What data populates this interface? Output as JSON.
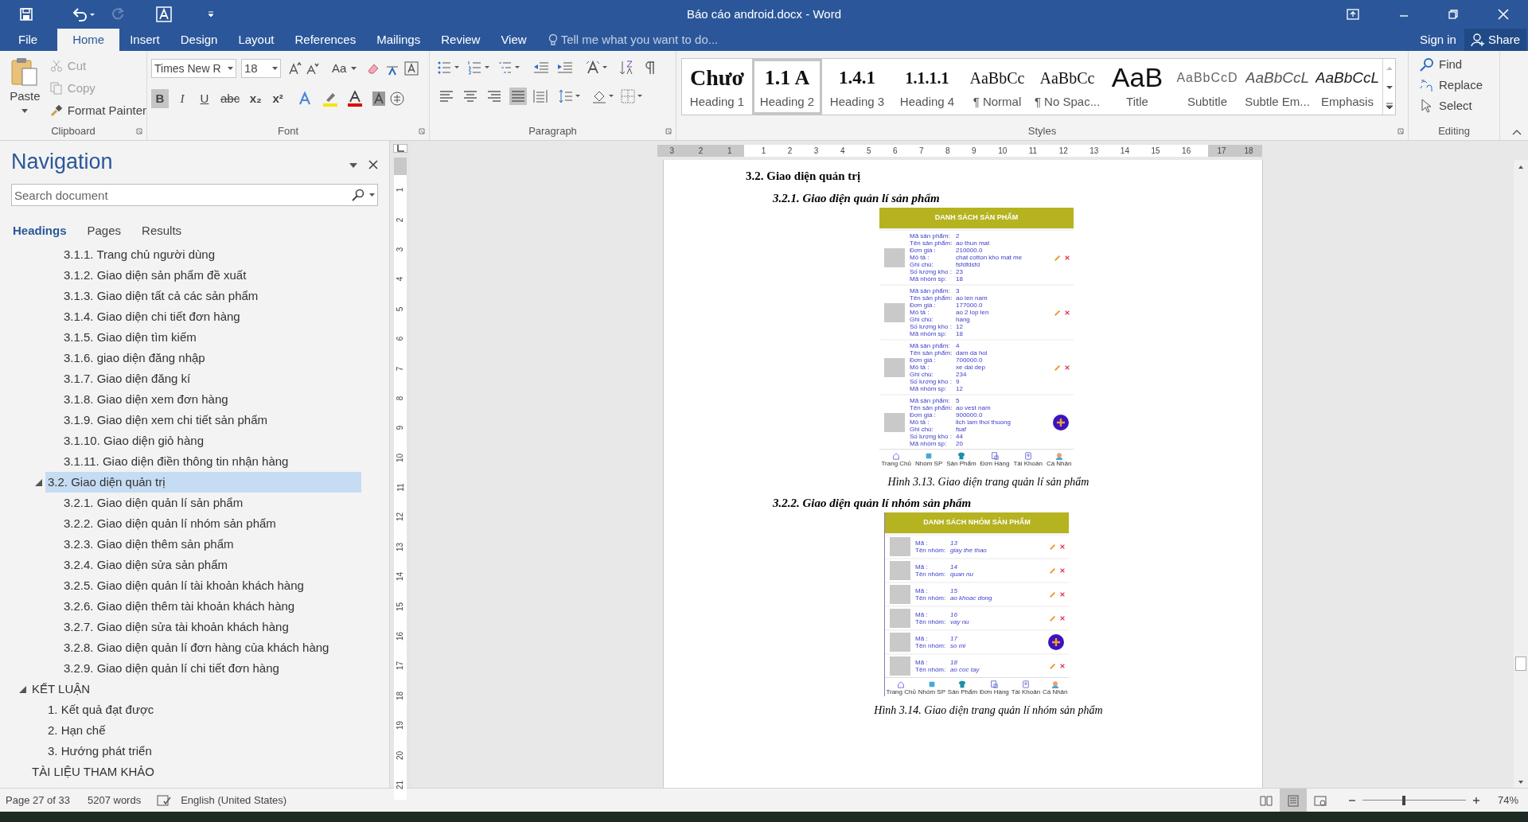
{
  "window": {
    "title": "Báo cáo android.docx - Word"
  },
  "ribbon_tabs": [
    {
      "label": "File",
      "selected": false
    },
    {
      "label": "Home",
      "selected": true
    },
    {
      "label": "Insert",
      "selected": false
    },
    {
      "label": "Design",
      "selected": false
    },
    {
      "label": "Layout",
      "selected": false
    },
    {
      "label": "References",
      "selected": false
    },
    {
      "label": "Mailings",
      "selected": false
    },
    {
      "label": "Review",
      "selected": false
    },
    {
      "label": "View",
      "selected": false
    }
  ],
  "tell_me": {
    "placeholder": "Tell me what you want to do..."
  },
  "account": {
    "sign_in": "Sign in",
    "share": "Share"
  },
  "clipboard": {
    "paste": "Paste",
    "cut": "Cut",
    "copy": "Copy",
    "format_painter": "Format Painter",
    "label": "Clipboard"
  },
  "font": {
    "name": "Times New R",
    "size": "18",
    "change_case": "Aa",
    "label": "Font",
    "format_buttons": [
      {
        "kind": "bold",
        "glyph": "B",
        "selected": true
      },
      {
        "kind": "italic",
        "glyph": "I",
        "selected": false
      },
      {
        "kind": "underline",
        "glyph": "U",
        "selected": false
      },
      {
        "kind": "strike",
        "glyph": "abc",
        "selected": false
      },
      {
        "kind": "sub",
        "glyph": "x₂",
        "selected": false
      },
      {
        "kind": "sup",
        "glyph": "x²",
        "selected": false
      }
    ]
  },
  "paragraph": {
    "label": "Paragraph",
    "alignment": [
      {
        "kind": "left",
        "selected": false
      },
      {
        "kind": "center",
        "selected": false
      },
      {
        "kind": "right",
        "selected": false
      },
      {
        "kind": "justify",
        "selected": true
      }
    ]
  },
  "styles": {
    "label": "Styles",
    "items": [
      {
        "kind": "heading1",
        "preview": "Chươ",
        "label": "Heading 1",
        "selected": false
      },
      {
        "kind": "heading2",
        "preview": "1.1  A",
        "label": "Heading 2",
        "selected": true
      },
      {
        "kind": "heading3",
        "preview": "1.4.1",
        "label": "Heading 3",
        "selected": false
      },
      {
        "kind": "heading4",
        "preview": "1.1.1.1",
        "label": "Heading 4",
        "selected": false
      },
      {
        "kind": "normal",
        "preview": "AaBbCc",
        "label": "¶ Normal",
        "selected": false
      },
      {
        "kind": "normal",
        "preview": "AaBbCc",
        "label": "¶ No Spac...",
        "selected": false
      },
      {
        "kind": "title",
        "preview": "AaB",
        "label": "Title",
        "selected": false
      },
      {
        "kind": "subtitle",
        "preview": "AaBbCcD",
        "label": "Subtitle",
        "selected": false
      },
      {
        "kind": "subtle",
        "preview": "AaBbCcL",
        "label": "Subtle Em...",
        "selected": false
      },
      {
        "kind": "emphasis",
        "preview": "AaBbCcL",
        "label": "Emphasis",
        "selected": false
      }
    ]
  },
  "editing": {
    "label": "Editing",
    "find": "Find",
    "replace": "Replace",
    "select": "Select"
  },
  "navigation": {
    "title": "Navigation",
    "search": {
      "placeholder": "Search document"
    },
    "tabs": [
      {
        "label": "Headings",
        "selected": true
      },
      {
        "label": "Pages",
        "selected": false
      },
      {
        "label": "Results",
        "selected": false
      }
    ],
    "headings": [
      {
        "children": [
          {
            "children": [
              {
                "label": "3.1.1. Trang chủ người dùng",
                "selected": false
              },
              {
                "label": "3.1.2. Giao diện sản phẩm đề xuất",
                "selected": false
              },
              {
                "label": "3.1.3. Giao diện tất cả các sản phẩm",
                "selected": false
              },
              {
                "label": "3.1.4. Giao diện chi tiết đơn hàng",
                "selected": false
              },
              {
                "label": "3.1.5. Giao diện tìm kiếm",
                "selected": false
              },
              {
                "label": "3.1.6. giao diện đăng nhập",
                "selected": false
              },
              {
                "label": "3.1.7. Giao diện đăng kí",
                "selected": false
              },
              {
                "label": "3.1.8. Giao diện xem đơn hàng",
                "selected": false
              },
              {
                "label": "3.1.9. Giao diện xem chi tiết sản phẩm",
                "selected": false
              },
              {
                "label": "3.1.10. Giao diện giỏ hàng",
                "selected": false
              },
              {
                "label": "3.1.11. Giao diện điền thông tin nhận hàng",
                "selected": false
              }
            ]
          },
          {
            "label": "3.2. Giao diện quản trị",
            "selected": true,
            "expanded": true,
            "children": [
              {
                "label": "3.2.1. Giao diện quản lí sản phẩm",
                "selected": false
              },
              {
                "label": "3.2.2. Giao diện quản lí nhóm sản phẩm",
                "selected": false
              },
              {
                "label": "3.2.3. Giao diện thêm sản phẩm",
                "selected": false
              },
              {
                "label": "3.2.4. Giao diện sửa sản phẩm",
                "selected": false
              },
              {
                "label": "3.2.5. Giao diện quản lí tài khoản khách hàng",
                "selected": false
              },
              {
                "label": "3.2.6. Giao diện thêm tài khoản khách hàng",
                "selected": false
              },
              {
                "label": "3.2.7. Giao diện sửa tài khoản khách hàng",
                "selected": false
              },
              {
                "label": "3.2.8. Giao diện quản lí đơn hàng của khách hàng",
                "selected": false
              },
              {
                "label": "3.2.9. Giao diện quản lí chi tiết đơn hàng",
                "selected": false
              }
            ]
          }
        ]
      },
      {
        "label": "KẾT LUẬN",
        "selected": false,
        "expanded": true,
        "children": [
          {
            "label": "1. Kết quả đạt được",
            "selected": false
          },
          {
            "label": "2. Hạn chế",
            "selected": false
          },
          {
            "label": "3. Hướng phát triển",
            "selected": false
          }
        ]
      },
      {
        "label": "TÀI LIỆU THAM KHẢO",
        "selected": false
      }
    ]
  },
  "ruler": {
    "horizontal": [
      "3",
      "2",
      "1",
      "1",
      "2",
      "3",
      "4",
      "5",
      "6",
      "7",
      "8",
      "9",
      "10",
      "11",
      "12",
      "13",
      "14",
      "15",
      "16",
      "17",
      "18"
    ],
    "vertical": [
      "1",
      "2",
      "3",
      "4",
      "5",
      "6",
      "7",
      "8",
      "9",
      "10",
      "11",
      "12",
      "13",
      "14",
      "15",
      "16",
      "17",
      "18",
      "19",
      "20",
      "21"
    ]
  },
  "document": {
    "heading": "3.2. Giao diện quản trị",
    "sections": [
      {
        "kind": "products",
        "heading": "3.2.1. Giao diện quản lí sản phẩm",
        "caption": "Hình 3.13. Giao diện trang quản lí sản phẩm",
        "screen": {
          "header": "DANH SÁCH  SẢN PHẨM",
          "nav": [
            "Trang Chủ",
            "Nhóm SP",
            "Sản Phẩm",
            "Đơn Hàng",
            "Tài Khoản",
            "Cá Nhân"
          ],
          "items": [
            {
              "fields": [
                {
                  "label": "Mã sản phẩm:",
                  "value": "2"
                },
                {
                  "label": "Tên sản phẩm:",
                  "value": "ao thun mat"
                },
                {
                  "label": "Đơn giá :",
                  "value": "210000.0"
                },
                {
                  "label": "Mô tả :",
                  "value": "chat cotton kho mat me"
                },
                {
                  "label": "Ghi chú:",
                  "value": "fsfdfdsfd"
                },
                {
                  "label": "Số lượng kho :",
                  "value": "23"
                },
                {
                  "label": "Mã nhóm sp:",
                  "value": "18"
                }
              ]
            },
            {
              "fields": [
                {
                  "label": "Mã sản phẩm:",
                  "value": "3"
                },
                {
                  "label": "Tên sản phẩm:",
                  "value": "ao len nam"
                },
                {
                  "label": "Đơn giá :",
                  "value": "177000.0"
                },
                {
                  "label": "Mô tả :",
                  "value": "ao 2 lop len"
                },
                {
                  "label": "Ghi chú:",
                  "value": "hang"
                },
                {
                  "label": "Số lượng kho :",
                  "value": "12"
                },
                {
                  "label": "Mã nhóm sp:",
                  "value": "18"
                }
              ]
            },
            {
              "fields": [
                {
                  "label": "Mã sản phẩm:",
                  "value": "4"
                },
                {
                  "label": "Tên sản phẩm:",
                  "value": "dam da hoi"
                },
                {
                  "label": "Đơn giá :",
                  "value": "700000.0"
                },
                {
                  "label": "Mô tả :",
                  "value": "xe dai dep"
                },
                {
                  "label": "Ghi chú:",
                  "value": "234"
                },
                {
                  "label": "Số lượng kho :",
                  "value": "9"
                },
                {
                  "label": "Mã nhóm sp:",
                  "value": "12"
                }
              ]
            },
            {
              "fields": [
                {
                  "label": "Mã sản phẩm:",
                  "value": "5"
                },
                {
                  "label": "Tên sản phẩm:",
                  "value": "ao vest nam"
                },
                {
                  "label": "Đơn giá :",
                  "value": "900000.0"
                },
                {
                  "label": "Mô tả :",
                  "value": "lich lam thoi thuong"
                },
                {
                  "label": "Ghi chú:",
                  "value": "fsaf"
                },
                {
                  "label": "Số lượng kho :",
                  "value": "44"
                },
                {
                  "label": "Mã nhóm sp:",
                  "value": "20"
                }
              ]
            }
          ]
        }
      },
      {
        "kind": "groups",
        "heading": "3.2.2. Giao diện quản lí nhóm sản phẩm",
        "caption": "Hình 3.14. Giao diện trang quản lí nhóm sản phẩm",
        "screen": {
          "header": "DANH SÁCH NHÓM SẢN PHẨM",
          "nav": [
            "Trang Chủ",
            "Nhóm SP",
            "Sản Phẩm",
            "Đơn Hàng",
            "Tài Khoản",
            "Cá Nhân"
          ],
          "items": [
            {
              "fields": [
                {
                  "label": "Mã :",
                  "value": "13"
                },
                {
                  "label": "Tên nhóm:",
                  "value": "giay the thao"
                }
              ]
            },
            {
              "fields": [
                {
                  "label": "Mã :",
                  "value": "14"
                },
                {
                  "label": "Tên nhóm:",
                  "value": "quan nu"
                }
              ]
            },
            {
              "fields": [
                {
                  "label": "Mã :",
                  "value": "15"
                },
                {
                  "label": "Tên nhóm:",
                  "value": "ao khoac dong"
                }
              ]
            },
            {
              "fields": [
                {
                  "label": "Mã :",
                  "value": "16"
                },
                {
                  "label": "Tên nhóm:",
                  "value": "vay nu"
                }
              ]
            },
            {
              "fields": [
                {
                  "label": "Mã :",
                  "value": "17"
                },
                {
                  "label": "Tên nhóm:",
                  "value": "so mi"
                }
              ]
            },
            {
              "fields": [
                {
                  "label": "Mã :",
                  "value": "18"
                },
                {
                  "label": "Tên nhóm:",
                  "value": "ao coc tay"
                }
              ]
            }
          ]
        }
      }
    ]
  },
  "status_bar": {
    "page": "Page 27 of 33",
    "words": "5207 words",
    "language": "English (United States)",
    "zoom": {
      "level": 0.4,
      "reading": "74%"
    },
    "view": [
      {
        "kind": "read",
        "selected": false
      },
      {
        "kind": "print",
        "selected": true
      },
      {
        "kind": "web",
        "selected": false
      }
    ]
  }
}
